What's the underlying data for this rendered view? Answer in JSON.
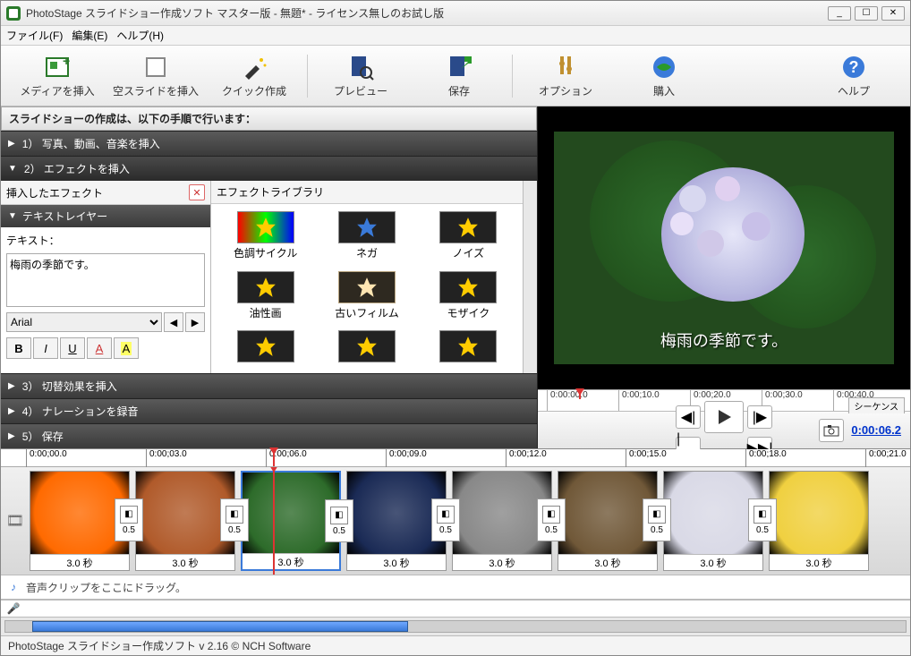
{
  "window": {
    "title": "PhotoStage スライドショー作成ソフト マスター版 - 無題* - ライセンス無しのお試し版",
    "min": "_",
    "max": "☐",
    "close": "✕"
  },
  "menubar": {
    "file": "ファイル(F)",
    "edit": "編集(E)",
    "help": "ヘルプ(H)"
  },
  "toolbar": {
    "insertMedia": "メディアを挿入",
    "insertBlank": "空スライドを挿入",
    "quickCreate": "クイック作成",
    "preview": "プレビュー",
    "save": "保存",
    "options": "オプション",
    "buy": "購入",
    "helpbtn": "ヘルプ"
  },
  "steps": {
    "headline": "スライドショーの作成は、以下の手順で行います：",
    "s1": "1）  写真、動画、音楽を挿入",
    "s2": "2）  エフェクトを挿入",
    "s3": "3）  切替効果を挿入",
    "s4": "4）  ナレーションを録音",
    "s5": "5）  保存"
  },
  "effects": {
    "insertedHdr": "挿入したエフェクト",
    "libraryHdr": "エフェクトライブラリ",
    "textLayerHdr": "テキストレイヤー",
    "textLabel": "テキスト：",
    "textValue": "梅雨の季節です。",
    "fontValue": "Arial",
    "items": [
      "色調サイクル",
      "ネガ",
      "ノイズ",
      "油性画",
      "古いフィルム",
      "モザイク"
    ]
  },
  "preview": {
    "caption": "梅雨の季節です。",
    "ticks": [
      "0:00:00.0",
      "0:00;10.0",
      "0:00;20.0",
      "0:00;30.0",
      "0:00;40.0"
    ],
    "seqLabel": "シーケンス",
    "timecode": "0:00:06.2"
  },
  "timeline": {
    "ticks": [
      "0:00;00.0",
      "0:00;03.0",
      "0:00;06.0",
      "0:00;09.0",
      "0:00;12.0",
      "0:00;15.0",
      "0:00;18.0",
      "0:00;21.0"
    ],
    "clipDur": "3.0 秒",
    "transDur": "0.5",
    "audioHint": "音声クリップをここにドラッグ。"
  },
  "status": "PhotoStage スライドショー作成ソフト v 2.16 © NCH Software",
  "colors": {
    "clips": [
      "#ff6a00",
      "#b05a2a",
      "#2d6b2a",
      "#1a2a55",
      "#888888",
      "#705838",
      "#d9d9e6",
      "#f0d040"
    ]
  }
}
